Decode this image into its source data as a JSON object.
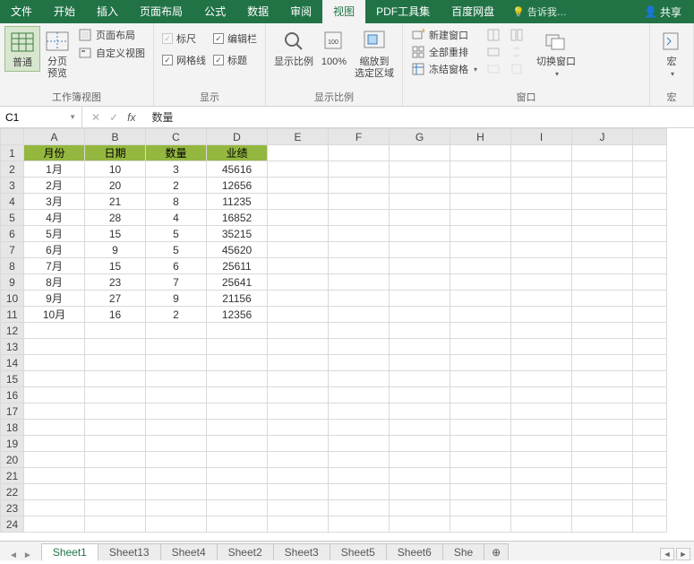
{
  "menu": {
    "tabs": [
      "文件",
      "开始",
      "插入",
      "页面布局",
      "公式",
      "数据",
      "审阅",
      "视图",
      "PDF工具集",
      "百度网盘"
    ],
    "active_index": 7,
    "tell_me": "告诉我…",
    "share": "共享"
  },
  "ribbon": {
    "group_views": {
      "label": "工作簿视图",
      "normal": "普通",
      "page_break": "分页\n预览",
      "page_layout": "页面布局",
      "custom_views": "自定义视图"
    },
    "group_show": {
      "label": "显示",
      "ruler": "标尺",
      "formula_bar": "编辑栏",
      "gridlines": "网格线",
      "headings": "标题"
    },
    "group_zoom": {
      "label": "显示比例",
      "zoom": "显示比例",
      "zoom100": "100%",
      "zoom_selection": "缩放到\n选定区域"
    },
    "group_window": {
      "label": "窗口",
      "new_window": "新建窗口",
      "arrange_all": "全部重排",
      "freeze_panes": "冻结窗格",
      "switch_windows": "切换窗口"
    },
    "group_macros": {
      "label": "宏",
      "macros": "宏"
    }
  },
  "formula_bar": {
    "cell_ref": "C1",
    "value": "数量"
  },
  "columns": [
    "A",
    "B",
    "C",
    "D",
    "E",
    "F",
    "G",
    "H",
    "I",
    "J"
  ],
  "headers": [
    "月份",
    "日期",
    "数量",
    "业绩"
  ],
  "rows": [
    {
      "a": "1月",
      "b": "10",
      "c": "3",
      "d": "45616"
    },
    {
      "a": "2月",
      "b": "20",
      "c": "2",
      "d": "12656"
    },
    {
      "a": "3月",
      "b": "21",
      "c": "8",
      "d": "11235"
    },
    {
      "a": "4月",
      "b": "28",
      "c": "4",
      "d": "16852"
    },
    {
      "a": "5月",
      "b": "15",
      "c": "5",
      "d": "35215"
    },
    {
      "a": "6月",
      "b": "9",
      "c": "5",
      "d": "45620"
    },
    {
      "a": "7月",
      "b": "15",
      "c": "6",
      "d": "25611"
    },
    {
      "a": "8月",
      "b": "23",
      "c": "7",
      "d": "25641"
    },
    {
      "a": "9月",
      "b": "27",
      "c": "9",
      "d": "21156"
    },
    {
      "a": "10月",
      "b": "16",
      "c": "2",
      "d": "12356"
    }
  ],
  "row_count": 24,
  "sheets": [
    "Sheet1",
    "Sheet13",
    "Sheet4",
    "Sheet2",
    "Sheet3",
    "Sheet5",
    "Sheet6",
    "She"
  ],
  "active_sheet": 0
}
